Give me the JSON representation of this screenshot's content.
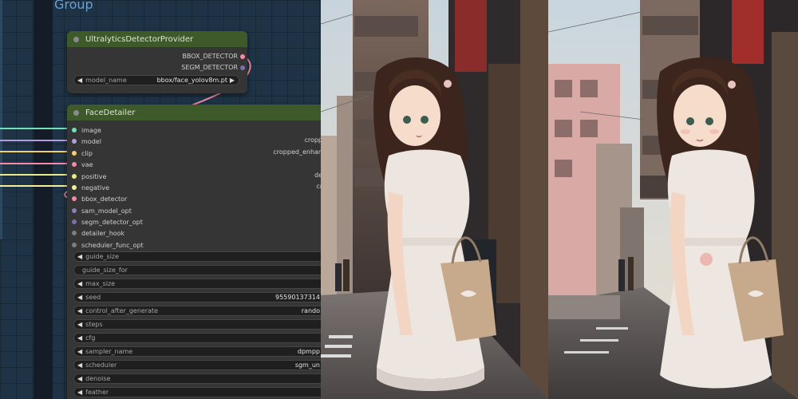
{
  "canvas": {
    "group_title": "Group"
  },
  "detector_node": {
    "title": "UltralyticsDetectorProvider",
    "outputs": [
      "BBOX_DETECTOR",
      "SEGM_DETECTOR"
    ],
    "model_widget": {
      "label": "model_name",
      "value": "bbox/face_yolov8m.pt"
    }
  },
  "face_detailer": {
    "title": "FaceDetailer",
    "inputs": [
      "image",
      "model",
      "clip",
      "vae",
      "positive",
      "negative",
      "bbox_detector",
      "sam_model_opt",
      "segm_detector_opt",
      "detailer_hook",
      "scheduler_func_opt"
    ],
    "outputs_visible": [
      "cropp",
      "cropped_enhan",
      "de",
      "cr"
    ],
    "widgets": [
      {
        "label": "guide_size",
        "value": ""
      },
      {
        "label": "guide_size_for",
        "value": ""
      },
      {
        "label": "max_size",
        "value": ""
      },
      {
        "label": "seed",
        "value": "95590137314"
      },
      {
        "label": "control_after_generate",
        "value": "rando"
      },
      {
        "label": "steps",
        "value": ""
      },
      {
        "label": "cfg",
        "value": ""
      },
      {
        "label": "sampler_name",
        "value": "dpmpp"
      },
      {
        "label": "scheduler",
        "value": "sgm_un"
      },
      {
        "label": "denoise",
        "value": ""
      },
      {
        "label": "feather",
        "value": ""
      }
    ]
  },
  "colors": {
    "node_header": "#3e5a2b",
    "node_body": "#353535",
    "canvas_bg": "#1e3346",
    "wire_image": "#6fe0b8",
    "wire_model": "#b39ddb",
    "wire_clip": "#f0d06b",
    "wire_vae": "#f48aa8",
    "wire_positive": "#e8ec8a",
    "wire_negative": "#f2ee9e"
  },
  "images": {
    "left": {
      "alt": "original anime girl in street"
    },
    "right": {
      "alt": "face-detailed anime girl in street"
    }
  }
}
